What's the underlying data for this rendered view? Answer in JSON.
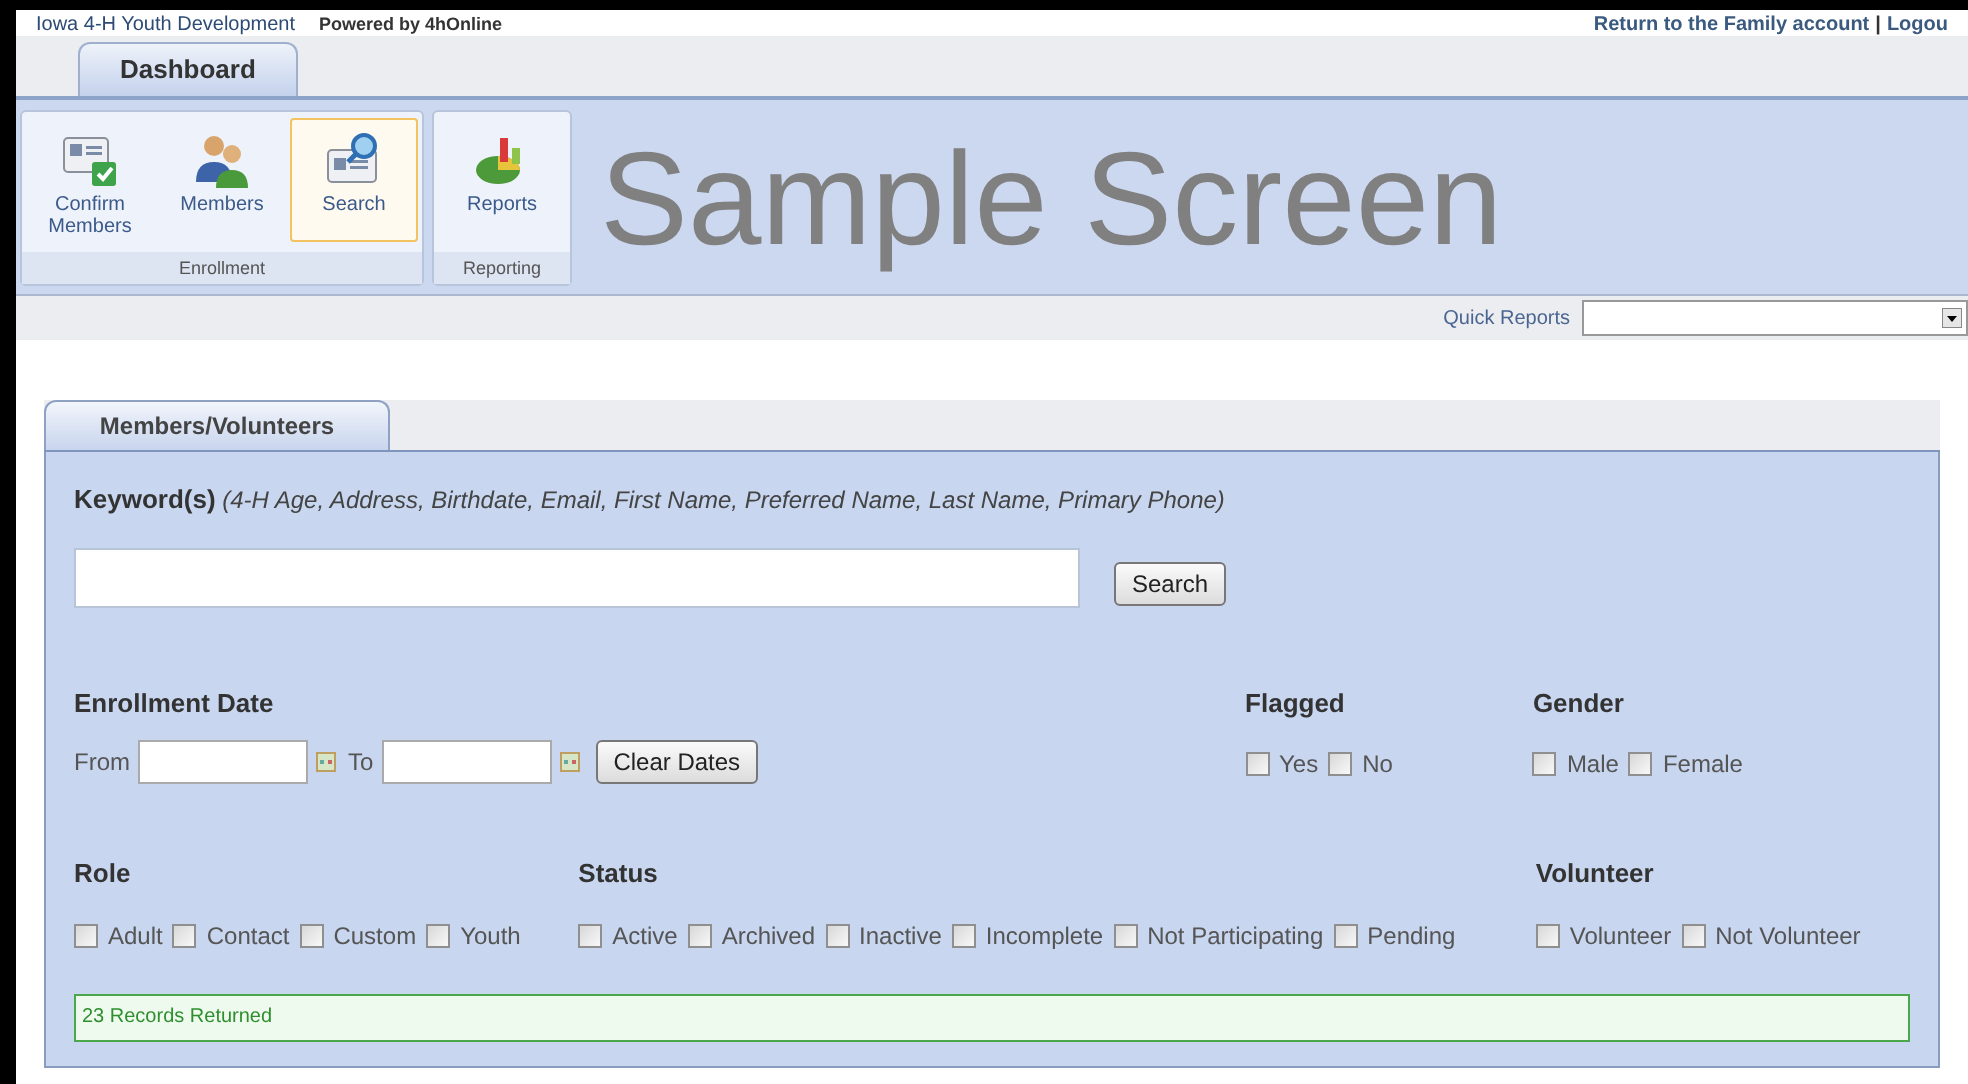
{
  "header": {
    "site_title": "Iowa 4-H Youth Development",
    "powered_by": "Powered by 4hOnline",
    "links": [
      {
        "label": "Return to the Family account"
      },
      {
        "label": "Logou"
      }
    ],
    "separator": "|"
  },
  "main_tabs": [
    {
      "label": "Dashboard",
      "selected": true
    }
  ],
  "ribbon": {
    "groups": [
      {
        "label": "Enrollment",
        "buttons": [
          {
            "label": "Confirm Members",
            "kind": "confirm",
            "selected": false
          },
          {
            "label": "Members",
            "kind": "members",
            "selected": false
          },
          {
            "label": "Search",
            "kind": "search",
            "selected": true
          }
        ]
      },
      {
        "label": "Reporting",
        "buttons": [
          {
            "label": "Reports",
            "kind": "reports",
            "selected": false
          }
        ]
      }
    ],
    "overlay_text": "Sample Screen"
  },
  "quick_reports": {
    "label": "Quick Reports"
  },
  "panel": {
    "tabs": [
      {
        "label": "Members/Volunteers",
        "selected": true
      }
    ],
    "keyword": {
      "label": "Keyword(s)",
      "hint": "(4-H Age, Address, Birthdate, Email, First Name, Preferred Name, Last Name, Primary Phone)",
      "button": "Search"
    },
    "enrollment_date": {
      "title": "Enrollment Date",
      "from_label": "From",
      "to_label": "To",
      "clear_button": "Clear Dates"
    },
    "flagged": {
      "title": "Flagged",
      "options": [
        {
          "label": "Yes",
          "checked": false
        },
        {
          "label": "No",
          "checked": false
        }
      ]
    },
    "gender": {
      "title": "Gender",
      "options": [
        {
          "label": "Male",
          "checked": false
        },
        {
          "label": "Female",
          "checked": false
        }
      ]
    },
    "role": {
      "title": "Role",
      "options": [
        {
          "label": "Adult",
          "checked": false
        },
        {
          "label": "Contact",
          "checked": false
        },
        {
          "label": "Custom",
          "checked": false
        },
        {
          "label": "Youth",
          "checked": false
        }
      ]
    },
    "status": {
      "title": "Status",
      "options": [
        {
          "label": "Active",
          "checked": false
        },
        {
          "label": "Archived",
          "checked": false
        },
        {
          "label": "Inactive",
          "checked": false
        },
        {
          "label": "Incomplete",
          "checked": false
        },
        {
          "label": "Not Participating",
          "checked": false
        },
        {
          "label": "Pending",
          "checked": false
        }
      ]
    },
    "volunteer": {
      "title": "Volunteer",
      "options": [
        {
          "label": "Volunteer",
          "checked": false
        },
        {
          "label": "Not Volunteer",
          "checked": false
        }
      ]
    },
    "result": "23 Records Returned"
  }
}
